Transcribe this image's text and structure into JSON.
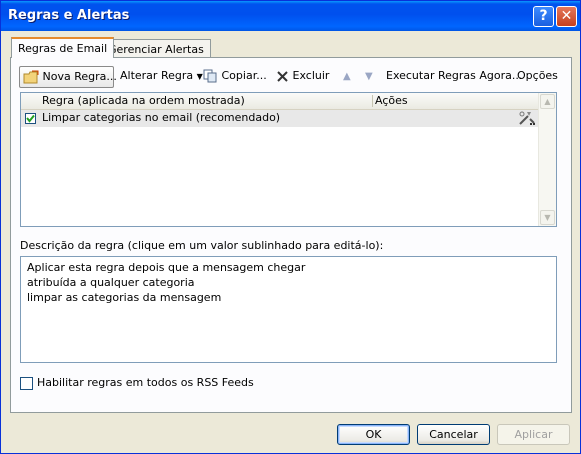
{
  "window": {
    "title": "Regras e Alertas",
    "help_label": "?",
    "close_label": "✕"
  },
  "tabs": [
    {
      "label": "Regras de Email",
      "active": true
    },
    {
      "label": "Gerenciar Alertas",
      "active": false
    }
  ],
  "toolbar": {
    "new_rule": "Nova Regra...",
    "change_rule": "Alterar Regra",
    "copy": "Copiar...",
    "delete": "Excluir",
    "run_rules": "Executar Regras Agora...",
    "options": "Opções"
  },
  "rules_table": {
    "columns": [
      "Regra (aplicada na ordem mostrada)",
      "Ações"
    ],
    "rows": [
      {
        "checked": true,
        "name": "Limpar categorias no email (recomendado)",
        "action_icon": "tools-icon"
      }
    ]
  },
  "description": {
    "label": "Descrição da regra (clique em um valor sublinhado para editá-lo):",
    "lines": [
      "Aplicar esta regra depois que a mensagem chegar",
      "atribuída a qualquer categoria",
      "limpar as categorias da mensagem"
    ]
  },
  "rss": {
    "checked": false,
    "label": "Habilitar regras em todos os RSS Feeds"
  },
  "buttons": {
    "ok": "OK",
    "cancel": "Cancelar",
    "apply": "Aplicar"
  },
  "colors": {
    "title_bar": "#0053ee",
    "dialog_bg": "#ece9d8",
    "accent_tab": "#e68b2c"
  }
}
